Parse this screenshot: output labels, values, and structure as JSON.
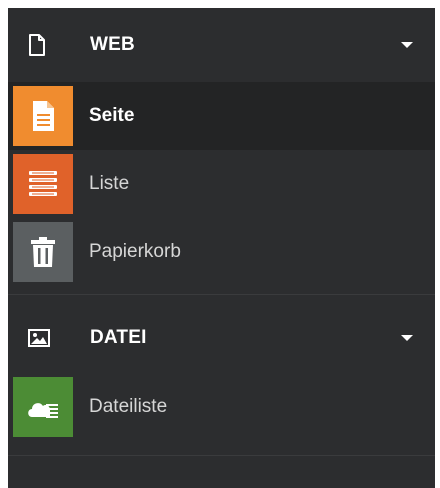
{
  "sidebar": {
    "groups": [
      {
        "label": "WEB",
        "icon": "page-outline-icon",
        "items": [
          {
            "label": "Seite",
            "icon": "page-icon",
            "color": "#f08c2f",
            "active": true
          },
          {
            "label": "Liste",
            "icon": "list-icon",
            "color": "#e0622a",
            "active": false
          },
          {
            "label": "Papierkorb",
            "icon": "trash-icon",
            "color": "#5b5f61",
            "active": false
          }
        ]
      },
      {
        "label": "DATEI",
        "icon": "image-icon",
        "items": [
          {
            "label": "Dateiliste",
            "icon": "cloud-list-icon",
            "color": "#4c8c35",
            "active": false
          }
        ]
      }
    ]
  }
}
